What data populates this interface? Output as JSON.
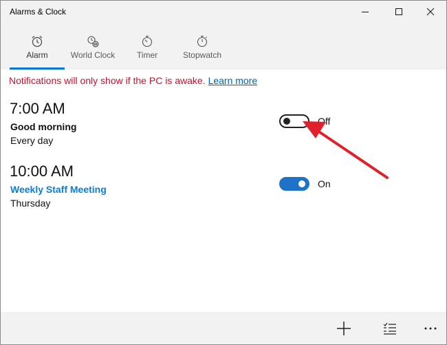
{
  "window": {
    "title": "Alarms & Clock"
  },
  "tabs": [
    {
      "label": "Alarm",
      "icon": "alarm-clock-icon",
      "selected": true
    },
    {
      "label": "World Clock",
      "icon": "world-clock-icon",
      "selected": false
    },
    {
      "label": "Timer",
      "icon": "timer-icon",
      "selected": false
    },
    {
      "label": "Stopwatch",
      "icon": "stopwatch-icon",
      "selected": false
    }
  ],
  "notice": {
    "text": "Notifications will only show if the PC is awake.",
    "link": "Learn more"
  },
  "alarms": [
    {
      "time": "7:00 AM",
      "name": "Good morning",
      "repeat": "Every day",
      "state_label": "Off",
      "enabled": false
    },
    {
      "time": "10:00 AM",
      "name": "Weekly Staff Meeting",
      "repeat": "Thursday",
      "state_label": "On",
      "enabled": true
    }
  ],
  "commands": [
    {
      "icon": "plus-icon",
      "action": "add-alarm"
    },
    {
      "icon": "select-list-icon",
      "action": "select-alarms"
    },
    {
      "icon": "more-icon",
      "action": "more-options"
    }
  ],
  "colors": {
    "accent": "#0078d7",
    "toggle_on": "#1f73c7",
    "notice_text": "#c8102e",
    "link": "#0063b1",
    "alarm_name_linked": "#0a7dd8",
    "annotation_arrow": "#e0212b"
  }
}
